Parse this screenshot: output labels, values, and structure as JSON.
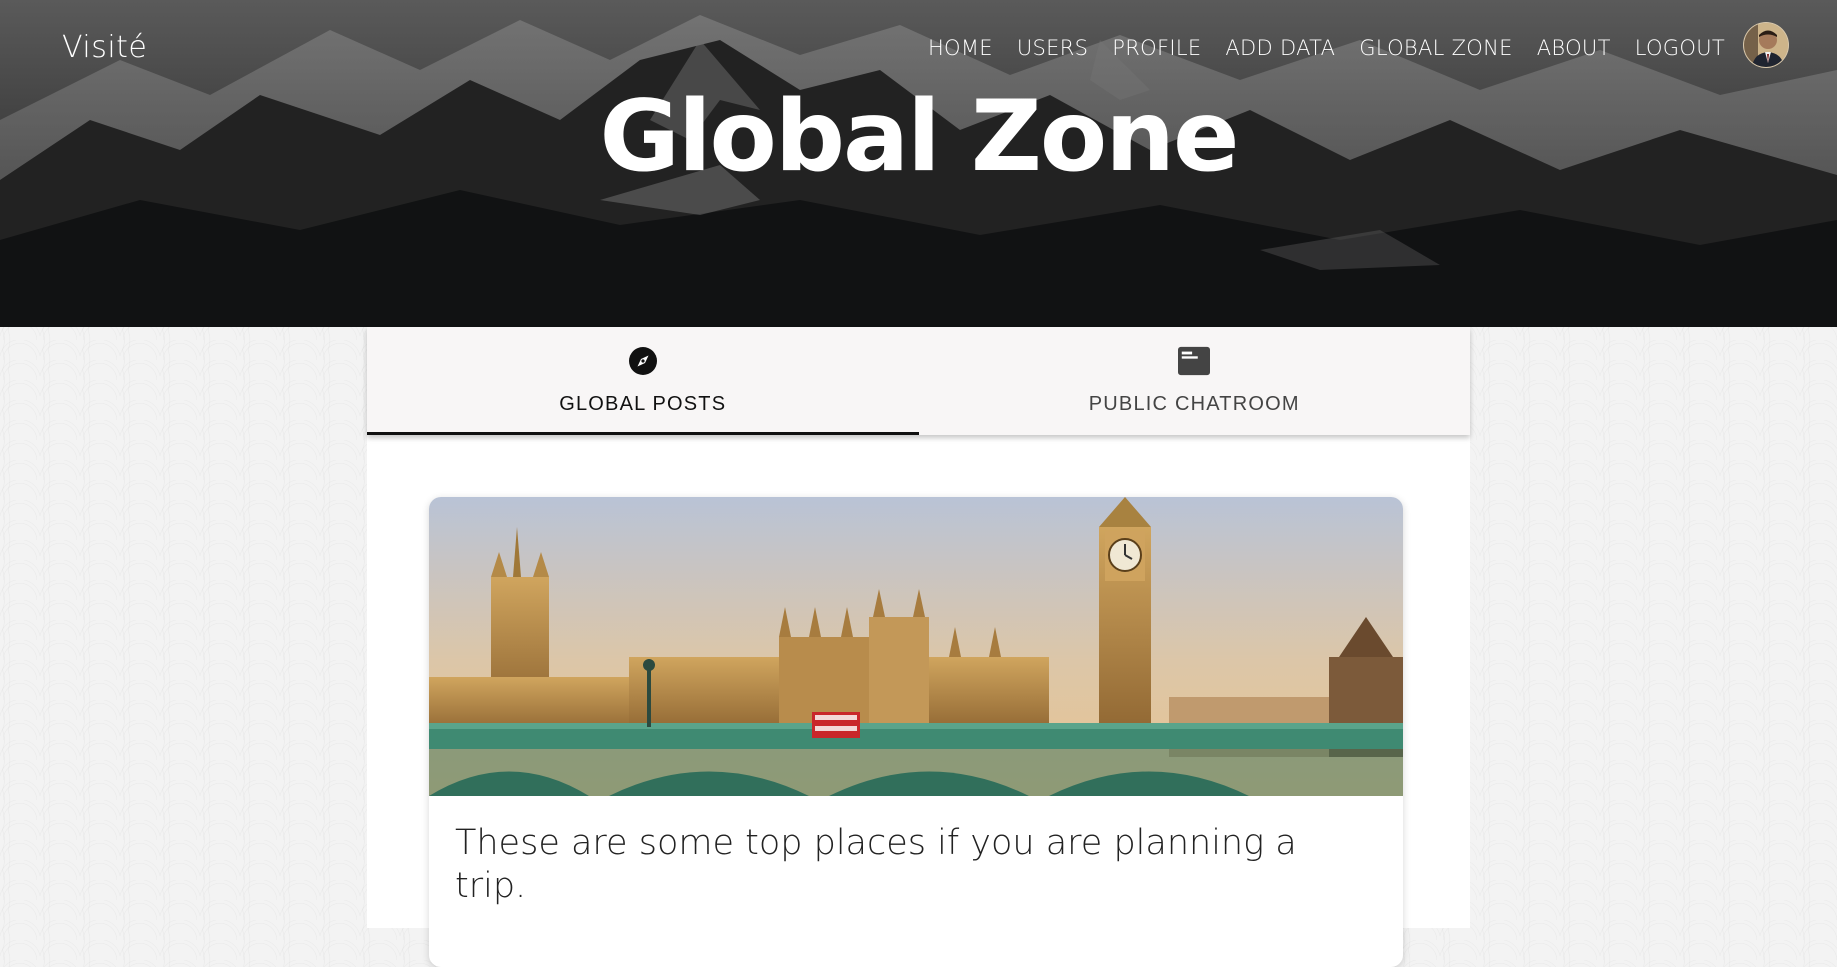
{
  "header": {
    "brand": "Visité",
    "nav": [
      {
        "label": "HOME"
      },
      {
        "label": "USERS"
      },
      {
        "label": "PROFILE"
      },
      {
        "label": "ADD DATA"
      },
      {
        "label": "GLOBAL ZONE"
      },
      {
        "label": "ABOUT"
      },
      {
        "label": "LOGOUT"
      }
    ],
    "avatar_icon": "user-avatar"
  },
  "page": {
    "title": "Global Zone"
  },
  "tabs": [
    {
      "label": "GLOBAL POSTS",
      "icon": "compass-icon",
      "active": true
    },
    {
      "label": "PUBLIC CHATROOM",
      "icon": "chat-icon",
      "active": false
    }
  ],
  "post": {
    "image_subject": "london-westminster-photo",
    "text": "These are some top places if you are planning a trip."
  },
  "colors": {
    "tab_bar": "#f8f6f6",
    "active_indicator": "#111111",
    "header_text": "#ffffff"
  }
}
